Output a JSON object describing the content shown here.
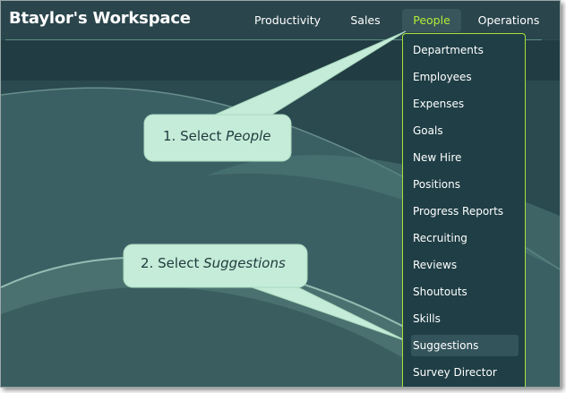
{
  "app": {
    "title": "Btaylor's Workspace"
  },
  "nav": {
    "tabs": [
      {
        "label": "Productivity",
        "active": false
      },
      {
        "label": "Sales",
        "active": false
      },
      {
        "label": "People",
        "active": true
      },
      {
        "label": "Operations",
        "active": false
      }
    ]
  },
  "dropdown": {
    "items": [
      {
        "label": "Departments"
      },
      {
        "label": "Employees"
      },
      {
        "label": "Expenses"
      },
      {
        "label": "Goals"
      },
      {
        "label": "New Hire"
      },
      {
        "label": "Positions"
      },
      {
        "label": "Progress Reports"
      },
      {
        "label": "Recruiting"
      },
      {
        "label": "Reviews"
      },
      {
        "label": "Shoutouts"
      },
      {
        "label": "Skills"
      },
      {
        "label": "Suggestions",
        "highlighted": true
      },
      {
        "label": "Survey Director"
      }
    ]
  },
  "callouts": [
    {
      "prefix": "1. Select ",
      "emphasis": "People"
    },
    {
      "prefix": "2. Select ",
      "emphasis": "Suggestions"
    }
  ],
  "colors": {
    "accent": "#b6ec37",
    "header_bg": "#2a454c",
    "menu_bg": "#1f3e45",
    "callout_fill": "#c5ecd8"
  }
}
